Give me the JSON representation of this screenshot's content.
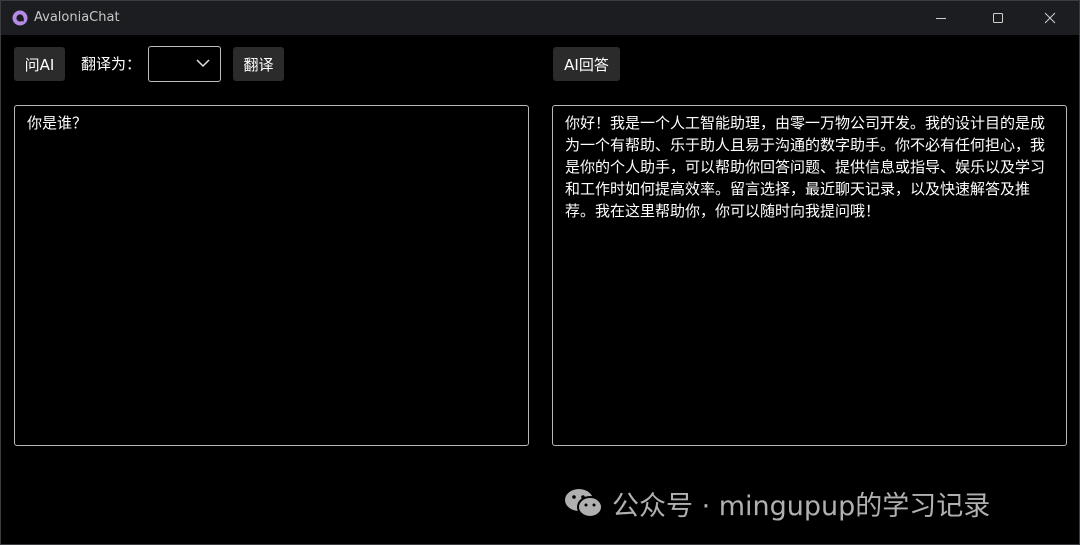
{
  "window": {
    "title": "AvaloniaChat",
    "icon": "avalonia-logo-icon",
    "controls": [
      "minimize-icon",
      "maximize-icon",
      "close-icon"
    ]
  },
  "toolbar": {
    "ask_ai_label": "问AI",
    "translate_to_label": "翻译为：",
    "language_select_value": "",
    "translate_label": "翻译",
    "ai_answer_label": "AI回答"
  },
  "question_box": {
    "value": "你是谁？"
  },
  "answer_box": {
    "value": "你好！我是一个人工智能助理，由零一万物公司开发。我的设计目的是成为一个有帮助、乐于助人且易于沟通的数字助手。你不必有任何担心，我是你的个人助手，可以帮助你回答问题、提供信息或指导、娱乐以及学习和工作时如何提高效率。留言选择，最近聊天记录，以及快速解答及推荐。我在这里帮助你，你可以随时向我提问哦！"
  },
  "watermark": {
    "text": "公众号 · mingupup的学习记录",
    "icon": "wechat-icon"
  },
  "colors": {
    "background": "#000000",
    "titlebar": "#1c1d20",
    "button": "#2b2b2b",
    "border": "#b8b8b8",
    "text": "#ffffff",
    "logo": "#b48ce6"
  }
}
